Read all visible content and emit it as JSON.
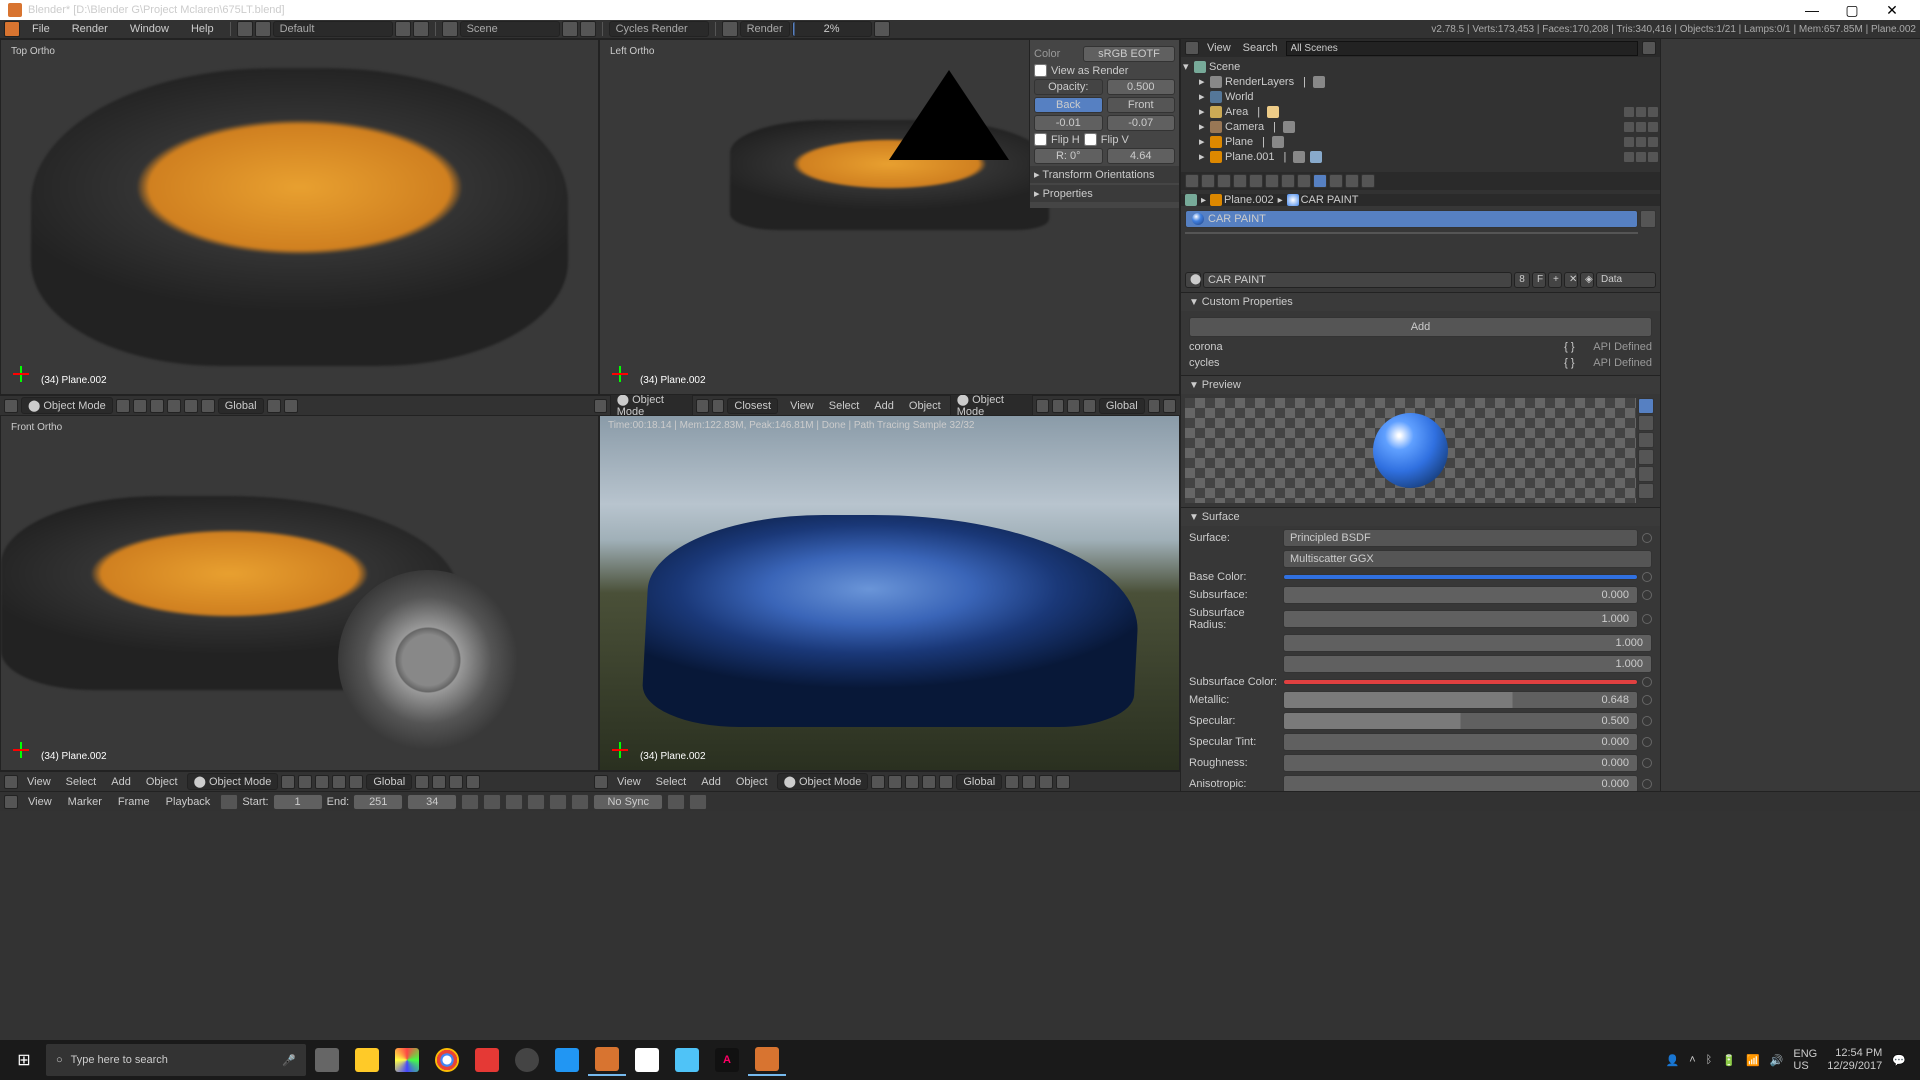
{
  "title": "Blender* [D:\\Blender G\\Project Mclaren\\675LT.blend]",
  "infobar": "v2.78.5 | Verts:173,453 | Faces:170,208 | Tris:340,416 | Objects:1/21 | Lamps:0/1 | Mem:657.85M | Plane.002",
  "menu": {
    "file": "File",
    "render": "Render",
    "window": "Window",
    "help": "Help",
    "layout": "Default",
    "scene": "Scene",
    "engine": "Cycles Render",
    "renderbtn": "Render",
    "progress": "2%"
  },
  "viewports": {
    "top": {
      "label": "Top Ortho",
      "obj": "(34) Plane.002"
    },
    "left": {
      "label": "Left Ortho",
      "obj": "(34) Plane.002"
    },
    "front": {
      "label": "Front Ortho",
      "obj": "(34) Plane.002"
    },
    "render": {
      "info": "Time:00:18.14 | Mem:122.83M, Peak:146.81M | Done | Path Tracing Sample 32/32",
      "obj": "(34) Plane.002"
    }
  },
  "vpheader": {
    "view": "View",
    "select": "Select",
    "add": "Add",
    "object": "Object",
    "mode": "Object Mode",
    "global": "Global",
    "closest": "Closest"
  },
  "npanel": {
    "color": "Color",
    "colorspace": "sRGB EOTF",
    "viewasrender": "View as Render",
    "opacity": "Opacity:",
    "opacityval": "0.500",
    "back": "Back",
    "front": "Front",
    "offx": "-0.01",
    "offy": "-0.07",
    "fliph": "Flip H",
    "flipv": "Flip V",
    "rot": "R: 0°",
    "scale": "4.64",
    "transforms": "Transform Orientations",
    "properties": "Properties"
  },
  "outliner": {
    "view": "View",
    "search": "Search",
    "filter": "All Scenes",
    "scene": "Scene",
    "renderlayers": "RenderLayers",
    "world": "World",
    "area": "Area",
    "camera": "Camera",
    "plane": "Plane",
    "plane001": "Plane.001"
  },
  "props": {
    "bc_obj": "Plane.002",
    "bc_mat": "CAR PAINT",
    "matname": "CAR PAINT",
    "matcount": "8",
    "f": "F",
    "data": "Data",
    "custom": "Custom Properties",
    "add": "Add",
    "corona": "corona",
    "cycles": "cycles",
    "brackets": "{ }",
    "apidef": "API Defined",
    "preview": "Preview",
    "surface": "Surface",
    "surfacelbl": "Surface:",
    "bsdf": "Principled BSDF",
    "distribution": "Multiscatter GGX",
    "basecolor": "Base Color:",
    "subsurface": "Subsurface:",
    "subsurfval": "0.000",
    "ssradius": "Subsurface Radius:",
    "ssr1": "1.000",
    "ssr2": "1.000",
    "ssr3": "1.000",
    "sscolor": "Subsurface Color:",
    "metallic": "Metallic:",
    "metallicval": "0.648",
    "specular": "Specular:",
    "specularval": "0.500",
    "spectint": "Specular Tint:",
    "spectintval": "0.000",
    "roughness": "Roughness:",
    "roughnessval": "0.000",
    "aniso": "Anisotropic:",
    "anisoval": "0.000"
  },
  "timeline": {
    "view": "View",
    "marker": "Marker",
    "frame": "Frame",
    "playback": "Playback",
    "start": "Start:",
    "startval": "1",
    "end": "End:",
    "endval": "251",
    "current": "34",
    "nosync": "No Sync"
  },
  "taskbar": {
    "search": "Type here to search",
    "lang": "ENG",
    "kbd": "US",
    "time": "12:54 PM",
    "date": "12/29/2017"
  }
}
